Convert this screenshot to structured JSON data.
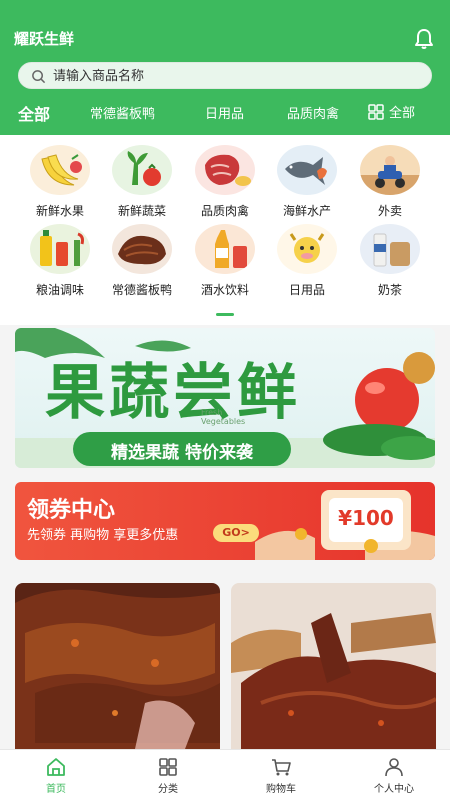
{
  "app": {
    "title": "耀跃生鲜"
  },
  "search": {
    "placeholder": "请输入商品名称"
  },
  "category_tabs": [
    {
      "label": "全部",
      "active": true
    },
    {
      "label": "常德酱板鸭",
      "active": false
    },
    {
      "label": "日用品",
      "active": false
    },
    {
      "label": "品质肉禽",
      "active": false
    }
  ],
  "all_categories_label": "全部",
  "category_grid": [
    {
      "label": "新鲜水果",
      "icon": "banana-icon"
    },
    {
      "label": "新鲜蔬菜",
      "icon": "vegetable-icon"
    },
    {
      "label": "品质肉禽",
      "icon": "meat-icon"
    },
    {
      "label": "海鲜水产",
      "icon": "fish-icon"
    },
    {
      "label": "外卖",
      "icon": "delivery-icon"
    },
    {
      "label": "粮油调味",
      "icon": "oil-icon"
    },
    {
      "label": "常德酱板鸭",
      "icon": "duck-icon"
    },
    {
      "label": "酒水饮料",
      "icon": "drink-icon"
    },
    {
      "label": "日用品",
      "icon": "cow-mascot-icon"
    },
    {
      "label": "奶茶",
      "icon": "milk-tea-icon"
    }
  ],
  "banner": {
    "headline": "果蔬尝鲜",
    "tag": "Fresh Vegetables",
    "subline": "精选果蔬 特价来袭"
  },
  "coupon": {
    "title": "领券中心",
    "subtitle": "先领券 再购物 享更多优惠",
    "go_label": "GO>",
    "amount": "¥100"
  },
  "bottom_nav": [
    {
      "label": "首页",
      "icon": "home-icon",
      "active": true
    },
    {
      "label": "分类",
      "icon": "category-icon",
      "active": false
    },
    {
      "label": "购物车",
      "icon": "cart-icon",
      "active": false
    },
    {
      "label": "个人中心",
      "icon": "user-icon",
      "active": false
    }
  ],
  "colors": {
    "brand_green": "#3dba5e",
    "coupon_red": "#ee4536"
  }
}
